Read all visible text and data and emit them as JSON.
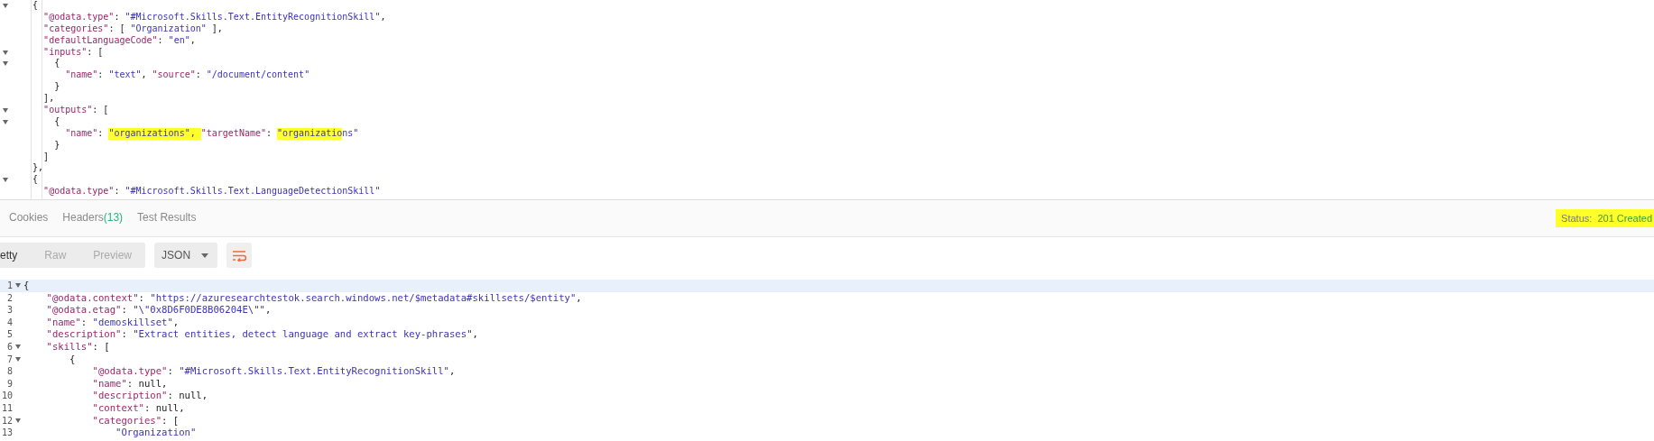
{
  "request_body": {
    "lines": [
      {
        "fold": true,
        "segments": [
          {
            "kind": "punct",
            "text": "    {"
          }
        ]
      },
      {
        "fold": false,
        "segments": [
          {
            "kind": "key",
            "text": "      \"@odata.type\""
          },
          {
            "kind": "punct",
            "text": ": "
          },
          {
            "kind": "string",
            "text": "\"#Microsoft.Skills.Text.EntityRecognitionSkill\""
          },
          {
            "kind": "punct",
            "text": ","
          }
        ]
      },
      {
        "fold": false,
        "segments": [
          {
            "kind": "key",
            "text": "      \"categories\""
          },
          {
            "kind": "punct",
            "text": ": [ "
          },
          {
            "kind": "string",
            "text": "\"Organization\""
          },
          {
            "kind": "punct",
            "text": " ],"
          }
        ]
      },
      {
        "fold": false,
        "segments": [
          {
            "kind": "key",
            "text": "      \"defaultLanguageCode\""
          },
          {
            "kind": "punct",
            "text": ": "
          },
          {
            "kind": "string",
            "text": "\"en\""
          },
          {
            "kind": "punct",
            "text": ","
          }
        ]
      },
      {
        "fold": true,
        "segments": [
          {
            "kind": "key",
            "text": "      \"inputs\""
          },
          {
            "kind": "punct",
            "text": ": ["
          }
        ]
      },
      {
        "fold": true,
        "segments": [
          {
            "kind": "punct",
            "text": "        {"
          }
        ]
      },
      {
        "fold": false,
        "segments": [
          {
            "kind": "key",
            "text": "          \"name\""
          },
          {
            "kind": "punct",
            "text": ": "
          },
          {
            "kind": "string",
            "text": "\"text\""
          },
          {
            "kind": "punct",
            "text": ", "
          },
          {
            "kind": "key",
            "text": "\"source\""
          },
          {
            "kind": "punct",
            "text": ": "
          },
          {
            "kind": "string",
            "text": "\"/document/content\""
          }
        ]
      },
      {
        "fold": false,
        "segments": [
          {
            "kind": "punct",
            "text": "        }"
          }
        ]
      },
      {
        "fold": false,
        "segments": [
          {
            "kind": "punct",
            "text": "      ],"
          }
        ]
      },
      {
        "fold": true,
        "segments": [
          {
            "kind": "key",
            "text": "      \"outputs\""
          },
          {
            "kind": "punct",
            "text": ": ["
          }
        ]
      },
      {
        "fold": true,
        "segments": [
          {
            "kind": "punct",
            "text": "        {"
          }
        ]
      },
      {
        "fold": false,
        "segments": [
          {
            "kind": "key",
            "text": "          \"name\""
          },
          {
            "kind": "punct",
            "text": ": "
          },
          {
            "kind": "string",
            "text": "\"organizations\", ",
            "highlighted": true
          },
          {
            "kind": "key",
            "text": "\"targetName\""
          },
          {
            "kind": "punct",
            "text": ": "
          },
          {
            "kind": "string",
            "text": "\"organizatio",
            "highlighted": true
          },
          {
            "kind": "string",
            "text": "ns\""
          }
        ]
      },
      {
        "fold": false,
        "segments": [
          {
            "kind": "punct",
            "text": "        }"
          }
        ]
      },
      {
        "fold": false,
        "segments": [
          {
            "kind": "punct",
            "text": "      ]"
          }
        ]
      },
      {
        "fold": false,
        "segments": [
          {
            "kind": "punct",
            "text": "    },"
          }
        ]
      },
      {
        "fold": true,
        "segments": [
          {
            "kind": "punct",
            "text": "    {"
          }
        ]
      },
      {
        "fold": false,
        "segments": [
          {
            "kind": "key",
            "text": "      \"@odata.type\""
          },
          {
            "kind": "punct",
            "text": ": "
          },
          {
            "kind": "string",
            "text": "\"#Microsoft.Skills.Text.LanguageDetectionSkill\""
          }
        ]
      }
    ]
  },
  "response_tabs": [
    {
      "label": "Cookies",
      "selected": false
    },
    {
      "label": "Headers",
      "count": "(13)",
      "selected": false
    },
    {
      "label": "Test Results",
      "selected": false
    }
  ],
  "status": {
    "label": "Status:",
    "value": "201 Created",
    "highlighted": true
  },
  "view_modes": [
    {
      "label": "etty",
      "selected": true
    },
    {
      "label": "Raw",
      "selected": false
    },
    {
      "label": "Preview",
      "selected": false
    }
  ],
  "format_dropdown": {
    "value": "JSON"
  },
  "response_body": {
    "lines": [
      {
        "number": "1",
        "fold": true,
        "current": true,
        "segments": [
          {
            "kind": "punct",
            "text": "{"
          }
        ]
      },
      {
        "number": "2",
        "fold": false,
        "current": false,
        "segments": [
          {
            "kind": "key",
            "text": "    \"@odata.context\""
          },
          {
            "kind": "punct",
            "text": ": "
          },
          {
            "kind": "string",
            "text": "\"https://azuresearchtestok.search.windows.net/$metadata#skillsets/$entity\""
          },
          {
            "kind": "punct",
            "text": ","
          }
        ]
      },
      {
        "number": "3",
        "fold": false,
        "current": false,
        "segments": [
          {
            "kind": "key",
            "text": "    \"@odata.etag\""
          },
          {
            "kind": "punct",
            "text": ": "
          },
          {
            "kind": "string",
            "text": "\"\\\"0x8D6F0DE8B06204E\\\"\""
          },
          {
            "kind": "punct",
            "text": ","
          }
        ]
      },
      {
        "number": "4",
        "fold": false,
        "current": false,
        "segments": [
          {
            "kind": "key",
            "text": "    \"name\""
          },
          {
            "kind": "punct",
            "text": ": "
          },
          {
            "kind": "string",
            "text": "\"demoskillset\""
          },
          {
            "kind": "punct",
            "text": ","
          }
        ]
      },
      {
        "number": "5",
        "fold": false,
        "current": false,
        "segments": [
          {
            "kind": "key",
            "text": "    \"description\""
          },
          {
            "kind": "punct",
            "text": ": "
          },
          {
            "kind": "string",
            "text": "\"Extract entities, detect language and extract key-phrases\""
          },
          {
            "kind": "punct",
            "text": ","
          }
        ]
      },
      {
        "number": "6",
        "fold": true,
        "current": false,
        "segments": [
          {
            "kind": "key",
            "text": "    \"skills\""
          },
          {
            "kind": "punct",
            "text": ": ["
          }
        ]
      },
      {
        "number": "7",
        "fold": true,
        "current": false,
        "segments": [
          {
            "kind": "punct",
            "text": "        {"
          }
        ]
      },
      {
        "number": "8",
        "fold": false,
        "current": false,
        "segments": [
          {
            "kind": "key",
            "text": "            \"@odata.type\""
          },
          {
            "kind": "punct",
            "text": ": "
          },
          {
            "kind": "string",
            "text": "\"#Microsoft.Skills.Text.EntityRecognitionSkill\""
          },
          {
            "kind": "punct",
            "text": ","
          }
        ]
      },
      {
        "number": "9",
        "fold": false,
        "current": false,
        "segments": [
          {
            "kind": "key",
            "text": "            \"name\""
          },
          {
            "kind": "punct",
            "text": ": null,"
          }
        ]
      },
      {
        "number": "10",
        "fold": false,
        "current": false,
        "segments": [
          {
            "kind": "key",
            "text": "            \"description\""
          },
          {
            "kind": "punct",
            "text": ": null,"
          }
        ]
      },
      {
        "number": "11",
        "fold": false,
        "current": false,
        "segments": [
          {
            "kind": "key",
            "text": "            \"context\""
          },
          {
            "kind": "punct",
            "text": ": null,"
          }
        ]
      },
      {
        "number": "12",
        "fold": true,
        "current": false,
        "segments": [
          {
            "kind": "key",
            "text": "            \"categories\""
          },
          {
            "kind": "punct",
            "text": ": ["
          }
        ]
      },
      {
        "number": "13",
        "fold": false,
        "current": false,
        "segments": [
          {
            "kind": "string",
            "text": "                \"Organization\""
          }
        ]
      }
    ]
  }
}
